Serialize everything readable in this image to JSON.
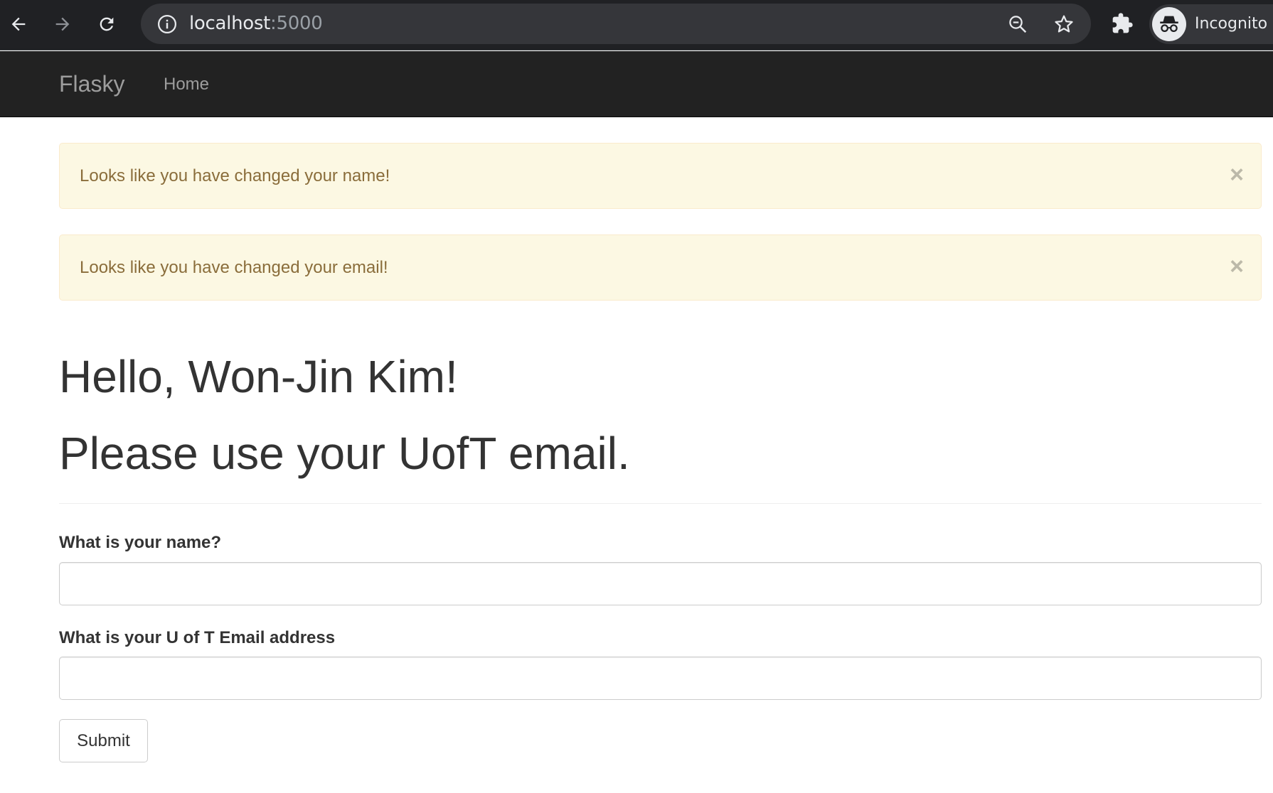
{
  "browser": {
    "url_host": "localhost",
    "url_port": ":5000",
    "profile_label": "Incognito"
  },
  "navbar": {
    "brand": "Flasky",
    "links": [
      {
        "label": "Home"
      }
    ]
  },
  "alerts": [
    {
      "message": "Looks like you have changed your name!",
      "close": "×"
    },
    {
      "message": "Looks like you have changed your email!",
      "close": "×"
    }
  ],
  "page": {
    "greeting": "Hello, Won-Jin Kim!",
    "subtitle": "Please use your UofT email."
  },
  "form": {
    "name_label": "What is your name?",
    "name_value": "",
    "email_label": "What is your U of T Email address",
    "email_value": "",
    "submit_label": "Submit"
  },
  "colors": {
    "chrome_bg": "#202124",
    "navbar_bg": "#222222",
    "alert_bg": "#fcf8e3",
    "alert_text": "#8a6d3b"
  }
}
